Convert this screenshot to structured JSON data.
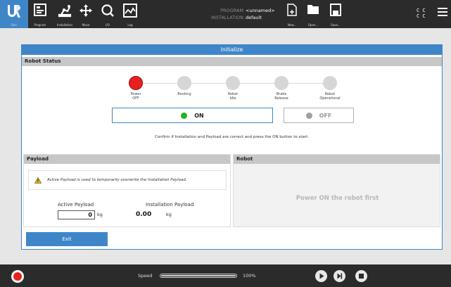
{
  "topbar": {
    "tabs": [
      {
        "label": "Run",
        "icon": "ur-logo-icon"
      },
      {
        "label": "Program",
        "icon": "program-icon"
      },
      {
        "label": "Installation",
        "icon": "installation-icon"
      },
      {
        "label": "Move",
        "icon": "move-icon"
      },
      {
        "label": "I/O",
        "icon": "io-icon"
      },
      {
        "label": "Log",
        "icon": "log-icon"
      }
    ],
    "program_key": "PROGRAM",
    "program_value": "<unnamed>",
    "installation_key": "INSTALLATION",
    "installation_value": "default",
    "file_buttons": [
      {
        "label": "New...",
        "icon": "new-file-icon"
      },
      {
        "label": "Open...",
        "icon": "open-folder-icon"
      },
      {
        "label": "Save...",
        "icon": "save-icon"
      }
    ],
    "cc_top": "C C",
    "cc_bottom": "C C",
    "menu_icon": "hamburger-menu-icon"
  },
  "dialog": {
    "title": "Initialize",
    "robot_status": {
      "header": "Robot Status",
      "steps": [
        {
          "line1": "Power",
          "line2": "OFF",
          "active": true
        },
        {
          "line1": "Booting",
          "line2": "",
          "active": false
        },
        {
          "line1": "Robot",
          "line2": "Idle",
          "active": false
        },
        {
          "line1": "Brake",
          "line2": "Release",
          "active": false
        },
        {
          "line1": "Robot",
          "line2": "Operational",
          "active": false
        }
      ],
      "on_label": "ON",
      "off_label": "OFF",
      "confirm_text": "Confirm if Installation and Payload are correct and press the ON button to start."
    },
    "payload": {
      "header": "Payload",
      "warning": "Active Payload is used to temporarily overwrite the Installation Payload.",
      "active_label": "Active Payload",
      "active_value": "0",
      "active_unit": "kg",
      "installation_label": "Installation Payload",
      "installation_value": "0.00",
      "installation_unit": "kg"
    },
    "robot": {
      "header": "Robot",
      "message": "Power ON the robot first"
    },
    "exit_label": "Exit"
  },
  "bottombar": {
    "speed_label": "Speed",
    "speed_value": "100%",
    "speed_fraction": 1.0,
    "controls": [
      "play-icon",
      "step-icon",
      "stop-icon"
    ]
  },
  "colors": {
    "accent": "#3f86c8",
    "topbar_bg": "#2b2b2b",
    "power_off_red": "#e8201f",
    "on_green": "#1fb31f"
  }
}
